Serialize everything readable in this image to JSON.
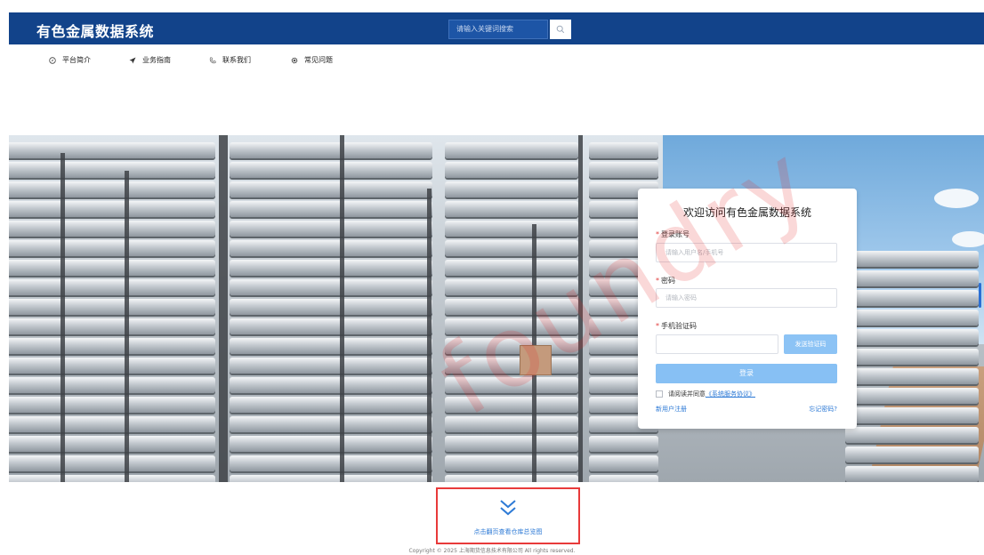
{
  "header": {
    "logo": "有色金属数据系统",
    "search_placeholder": "请输入关键词搜索"
  },
  "nav": {
    "items": [
      {
        "label": "平台简介",
        "icon": "compass-icon"
      },
      {
        "label": "业务指南",
        "icon": "send-icon"
      },
      {
        "label": "联系我们",
        "icon": "phone-icon"
      },
      {
        "label": "常见问题",
        "icon": "gear-icon"
      }
    ]
  },
  "login": {
    "title": "欢迎访问有色金属数据系统",
    "account_label": "登录账号",
    "account_placeholder": "请输入用户名/手机号",
    "password_label": "密码",
    "password_placeholder": "请输入密码",
    "sms_label": "手机验证码",
    "send_code": "发送验证码",
    "login_button": "登录",
    "agree_text": "请阅读并同意",
    "agree_link": "《系统服务协议》",
    "register": "新用户注册",
    "forgot": "忘记密码?"
  },
  "footer": {
    "more_text": "点击翻页查看仓库总览图",
    "copyright": "Copyright © 2025 上海期货信息技术有限公司 All rights reserved."
  },
  "watermark": "foundry",
  "colors": {
    "header_bg": "#12438a",
    "accent": "#2d7ad6",
    "button_light": "#87c0f4",
    "highlight_border": "#e83a3a"
  }
}
